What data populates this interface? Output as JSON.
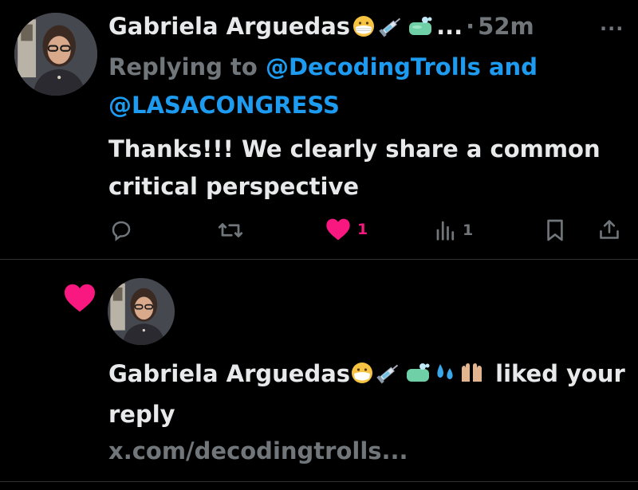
{
  "tweet": {
    "author_name": "Gabriela Arguedas",
    "name_ellipsis": "...",
    "separator": "·",
    "time": "52m",
    "more_label": "···",
    "replying_prefix": "Replying to",
    "mention_1": "@DecodingTrolls",
    "conjunction": "and",
    "mention_2": "@LASACONGRESS",
    "text": "Thanks!!! We clearly share a common critical perspective",
    "actions": {
      "reply_count": "",
      "repost_count": "",
      "like_count": "1",
      "views_count": "1"
    }
  },
  "notification": {
    "actor_name": "Gabriela Arguedas",
    "action_text": "liked your reply",
    "link_text": "x.com/decodingtrolls..."
  },
  "icons": {
    "reply": "reply-icon",
    "repost": "repost-icon",
    "like": "heart-icon",
    "views": "views-icon",
    "bookmark": "bookmark-icon",
    "share": "share-icon"
  },
  "colors": {
    "background": "#000000",
    "primary_text": "#e7e9ea",
    "secondary_text": "#71767b",
    "mention": "#1d9bf0",
    "like": "#f91880",
    "divider": "#2f3336"
  }
}
